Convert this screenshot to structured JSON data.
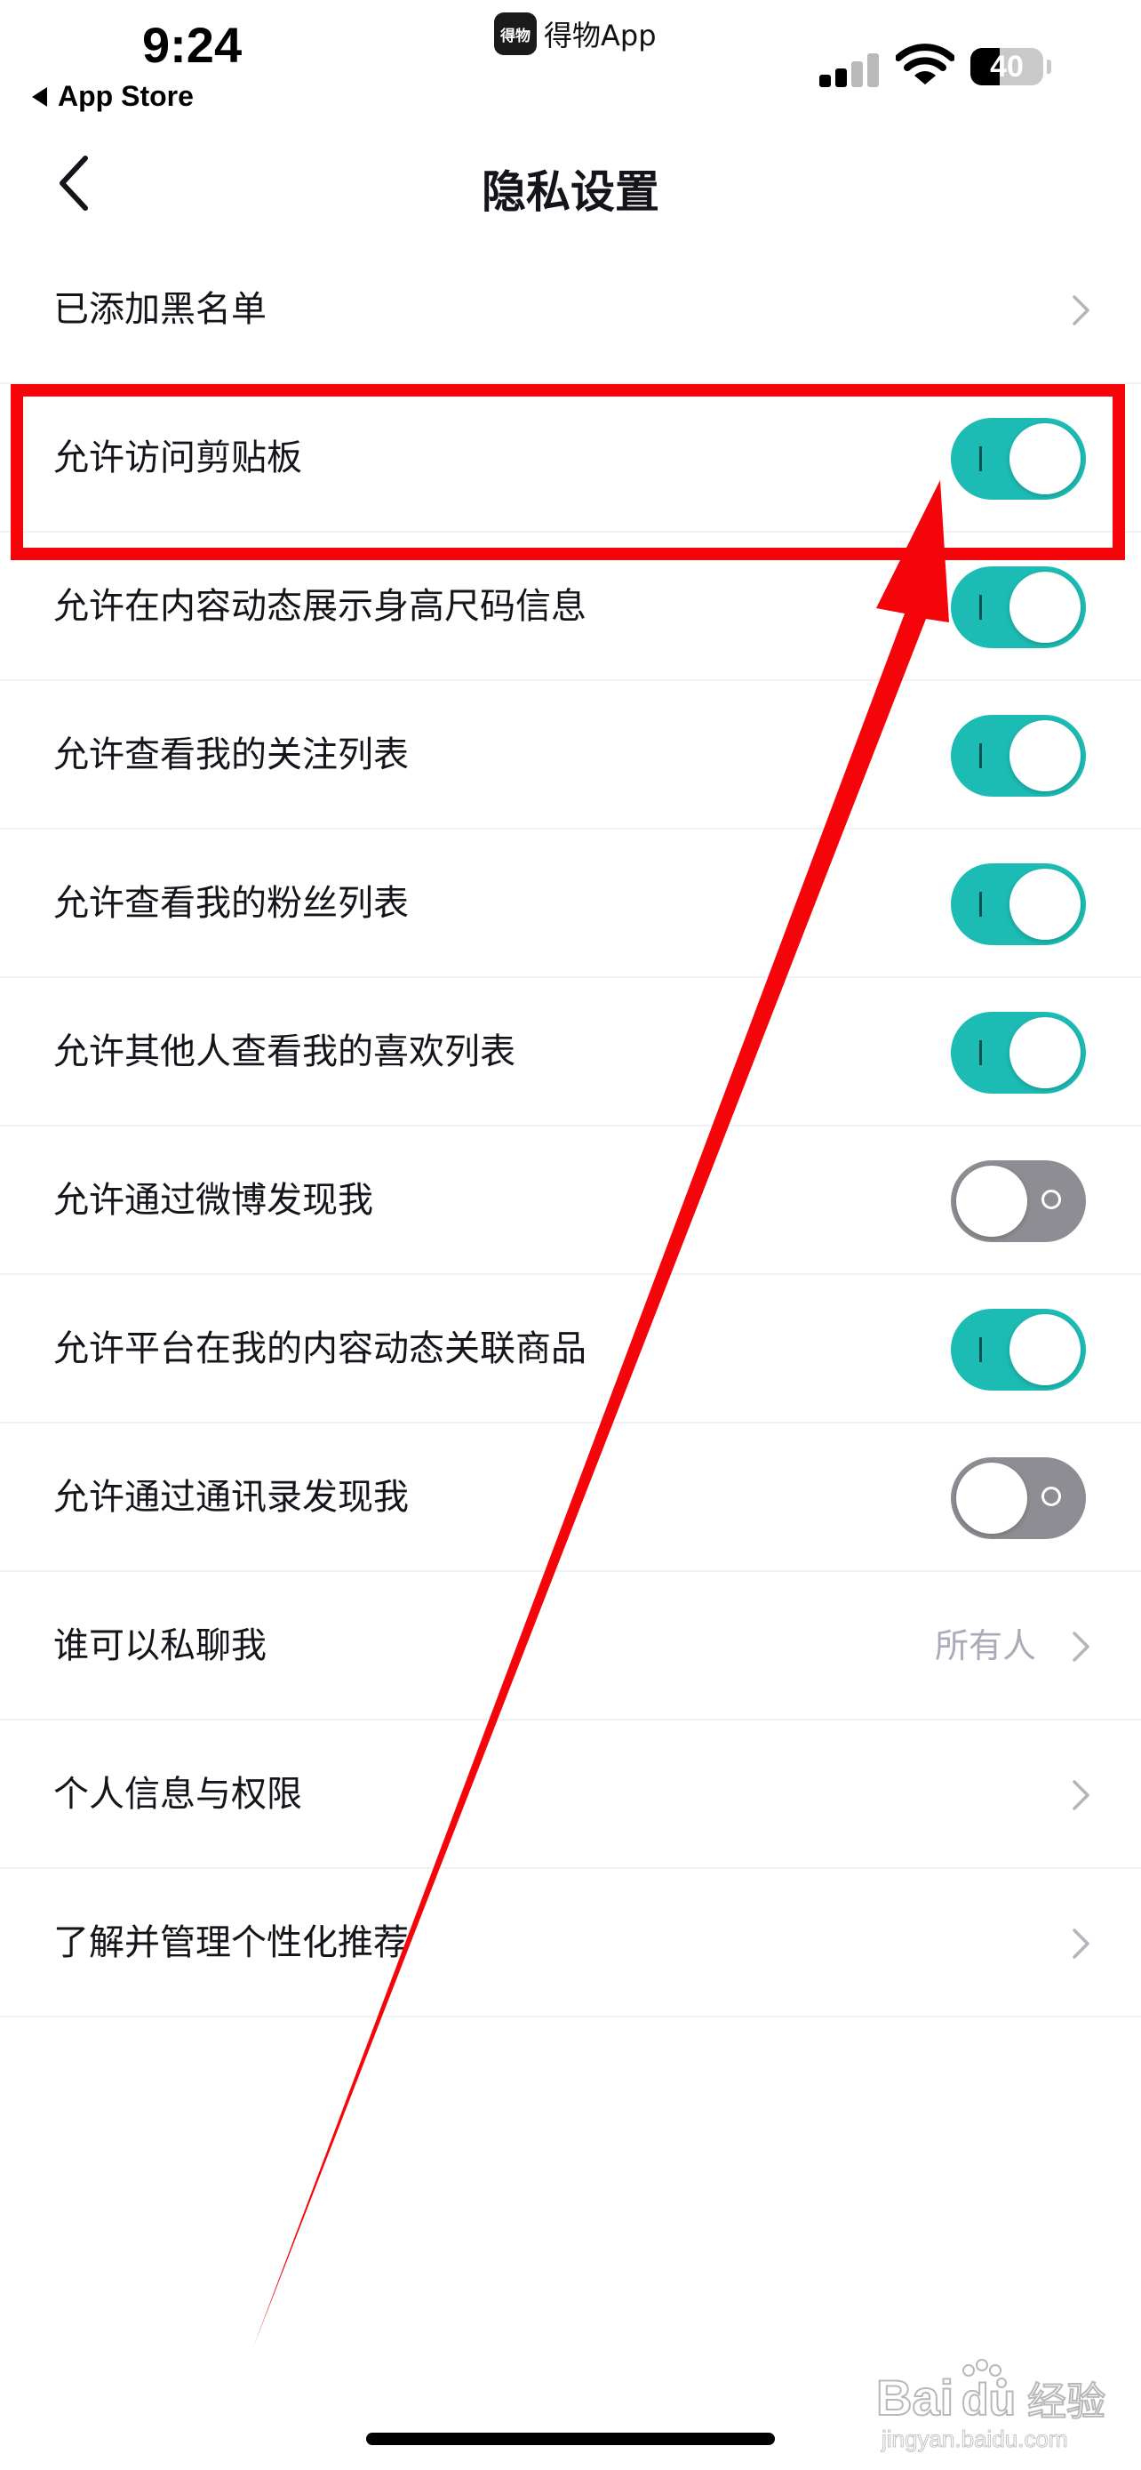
{
  "status_bar": {
    "time": "9:24",
    "back_app": "App Store",
    "notch_app_logo": "得物",
    "notch_app_name": "得物App",
    "battery": "40",
    "battery_level": 0.4,
    "icons": [
      "cellular-signal-icon",
      "wifi-icon",
      "battery-icon"
    ]
  },
  "nav": {
    "title": "隐私设置",
    "back_icon": "chevron-left-icon"
  },
  "settings": [
    {
      "label": "已添加黑名单",
      "control": "chevron"
    },
    {
      "label": "允许访问剪贴板",
      "control": "toggle",
      "on": true
    },
    {
      "label": "允许在内容动态展示身高尺码信息",
      "control": "toggle",
      "on": true
    },
    {
      "label": "允许查看我的关注列表",
      "control": "toggle",
      "on": true
    },
    {
      "label": "允许查看我的粉丝列表",
      "control": "toggle",
      "on": true
    },
    {
      "label": "允许其他人查看我的喜欢列表",
      "control": "toggle",
      "on": true
    },
    {
      "label": "允许通过微博发现我",
      "control": "toggle",
      "on": false
    },
    {
      "label": "允许平台在我的内容动态关联商品",
      "control": "toggle",
      "on": true
    },
    {
      "label": "允许通过通讯录发现我",
      "control": "toggle",
      "on": false
    },
    {
      "label": "谁可以私聊我",
      "control": "chevron",
      "value": "所有人"
    },
    {
      "label": "个人信息与权限",
      "control": "chevron"
    },
    {
      "label": "了解并管理个性化推荐",
      "control": "chevron"
    }
  ],
  "colors": {
    "toggle_on": "#1cbcb4",
    "toggle_off": "#8d8d93",
    "annotation_red": "#f5050a"
  },
  "watermark": {
    "logo": "Bai",
    "logo_paw": "du",
    "brand": "经验",
    "url": "jingyan.baidu.com"
  }
}
